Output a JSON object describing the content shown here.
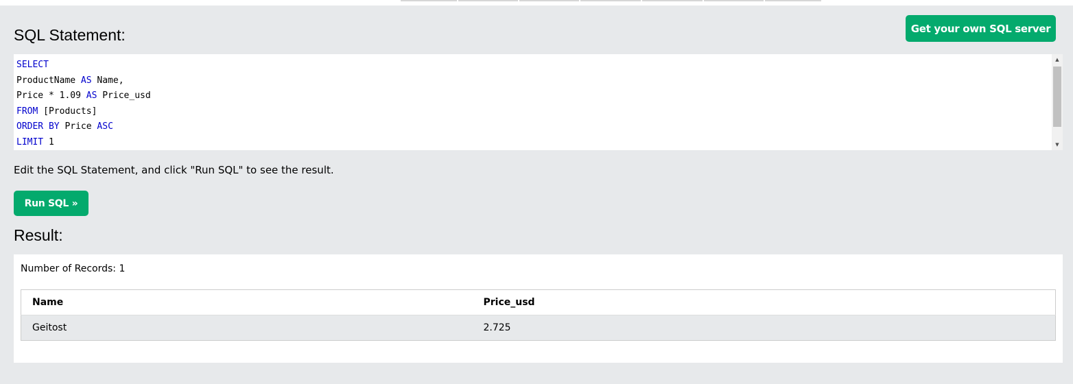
{
  "sql_section": {
    "heading": "SQL Statement:",
    "own_server_button": "Get your own SQL server",
    "code_lines": [
      [
        {
          "t": "SELECT",
          "kw": true
        }
      ],
      [
        {
          "t": "ProductName ",
          "kw": false
        },
        {
          "t": "AS",
          "kw": true
        },
        {
          "t": " Name,",
          "kw": false
        }
      ],
      [
        {
          "t": "Price * 1.09 ",
          "kw": false
        },
        {
          "t": "AS",
          "kw": true
        },
        {
          "t": " Price_usd",
          "kw": false
        }
      ],
      [
        {
          "t": "FROM",
          "kw": true
        },
        {
          "t": " [Products]",
          "kw": false
        }
      ],
      [
        {
          "t": "ORDER BY",
          "kw": true
        },
        {
          "t": " Price ",
          "kw": false
        },
        {
          "t": "ASC",
          "kw": true
        }
      ],
      [
        {
          "t": "LIMIT",
          "kw": true
        },
        {
          "t": " 1",
          "kw": false
        }
      ]
    ],
    "instruction": "Edit the SQL Statement, and click \"Run SQL\" to see the result.",
    "run_button": "Run SQL »"
  },
  "result_section": {
    "heading": "Result:",
    "record_count": "Number of Records: 1",
    "columns": [
      "Name",
      "Price_usd"
    ],
    "rows": [
      [
        "Geitost",
        "2.725"
      ]
    ]
  },
  "colors": {
    "accent_green": "#04aa6d",
    "sql_keyword": "#0000cd",
    "panel_background": "#e7e9eb"
  },
  "icons": {
    "scroll_up": "scroll-up-arrow-icon",
    "scroll_down": "scroll-down-arrow-icon"
  }
}
